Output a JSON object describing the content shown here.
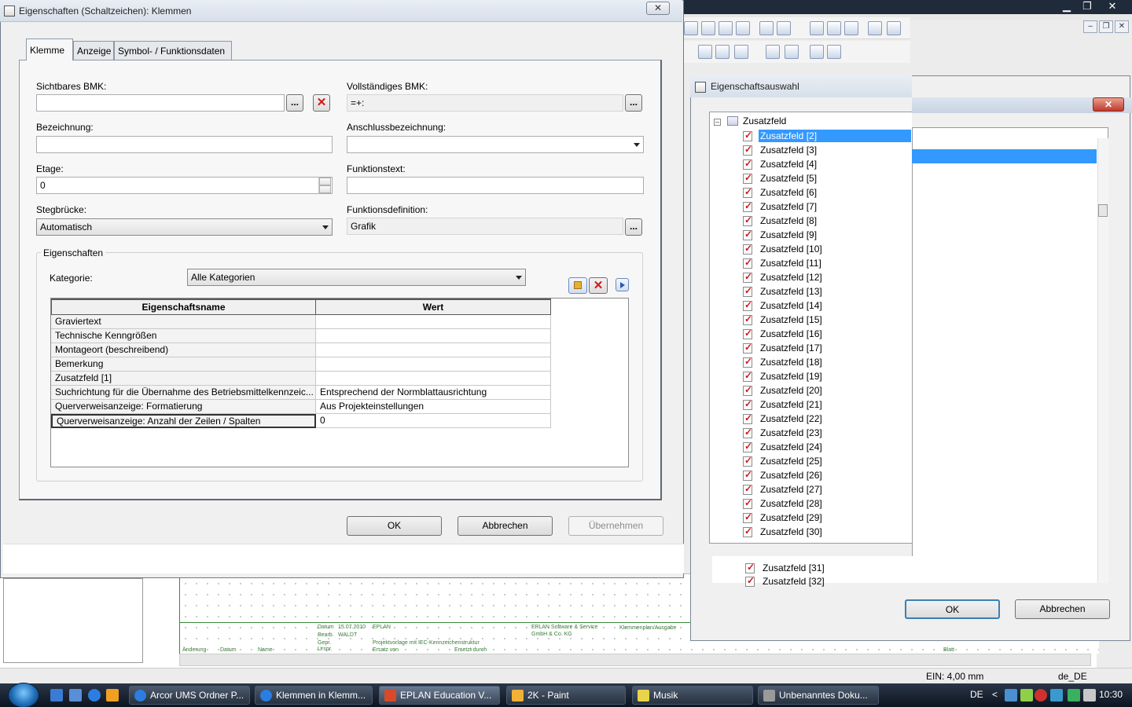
{
  "main_dialog": {
    "title": "Eigenschaften (Schaltzeichen): Klemmen",
    "close_glyph": "✕",
    "tabs": [
      "Klemme",
      "Anzeige",
      "Symbol- / Funktionsdaten"
    ],
    "fields": {
      "sichtbares_bmk": {
        "label": "Sichtbares BMK:",
        "value": ""
      },
      "vollstaendiges_bmk": {
        "label": "Vollständiges BMK:",
        "value": "=+:"
      },
      "bezeichnung": {
        "label": "Bezeichnung:",
        "value": ""
      },
      "anschlussbezeichnung": {
        "label": "Anschlussbezeichnung:",
        "value": ""
      },
      "etage": {
        "label": "Etage:",
        "value": "0"
      },
      "funktionstext": {
        "label": "Funktionstext:",
        "value": ""
      },
      "stegbruecke": {
        "label": "Stegbrücke:",
        "value": "Automatisch"
      },
      "funktionsdefinition": {
        "label": "Funktionsdefinition:",
        "value": "Grafik"
      }
    },
    "dots_label": "...",
    "delete_glyph": "✕",
    "properties_group": {
      "title": "Eigenschaften",
      "category_label": "Kategorie:",
      "category_value": "Alle Kategorien",
      "columns": [
        "Eigenschaftsname",
        "Wert"
      ],
      "rows": [
        {
          "name": "Graviertext",
          "value": ""
        },
        {
          "name": "Technische Kenngrößen",
          "value": ""
        },
        {
          "name": "Montageort (beschreibend)",
          "value": ""
        },
        {
          "name": "Bemerkung",
          "value": ""
        },
        {
          "name": "Zusatzfeld [1]",
          "value": ""
        },
        {
          "name": "Suchrichtung für die Übernahme des Betriebsmittelkennzeic...",
          "value": "Entsprechend der Normblattausrichtung"
        },
        {
          "name": "Querverweisanzeige: Formatierung",
          "value": "Aus Projekteinstellungen"
        },
        {
          "name": "Querverweisanzeige: Anzahl der Zeilen / Spalten",
          "value": "0"
        }
      ],
      "selected_row": 7
    },
    "buttons": {
      "ok": "OK",
      "cancel": "Abbrechen",
      "apply": "Übernehmen"
    }
  },
  "selection_dialog": {
    "title": "Eigenschaftsauswahl",
    "close_glyph": "✕",
    "root": "Zusatzfeld",
    "items": [
      "Zusatzfeld [2]",
      "Zusatzfeld [3]",
      "Zusatzfeld [4]",
      "Zusatzfeld [5]",
      "Zusatzfeld [6]",
      "Zusatzfeld [7]",
      "Zusatzfeld [8]",
      "Zusatzfeld [9]",
      "Zusatzfeld [10]",
      "Zusatzfeld [11]",
      "Zusatzfeld [12]",
      "Zusatzfeld [13]",
      "Zusatzfeld [14]",
      "Zusatzfeld [15]",
      "Zusatzfeld [16]",
      "Zusatzfeld [17]",
      "Zusatzfeld [18]",
      "Zusatzfeld [19]",
      "Zusatzfeld [20]",
      "Zusatzfeld [21]",
      "Zusatzfeld [22]",
      "Zusatzfeld [23]",
      "Zusatzfeld [24]",
      "Zusatzfeld [25]",
      "Zusatzfeld [26]",
      "Zusatzfeld [27]",
      "Zusatzfeld [28]",
      "Zusatzfeld [29]",
      "Zusatzfeld [30]"
    ],
    "tail_items": [
      "Zusatzfeld [31]",
      "Zusatzfeld [32]"
    ],
    "selected_item": 0,
    "buttons": {
      "ok": "OK",
      "cancel": "Abbrechen"
    }
  },
  "background_app": {
    "window_buttons": [
      "▁",
      "❐",
      "✕"
    ],
    "mdi_buttons": [
      "–",
      "❐",
      "✕"
    ],
    "status_ein": "EIN: 4,00 mm",
    "status_locale": "de_DE",
    "titleblock_cells": [
      "Datum",
      "15.07.2010",
      "Bearb.",
      "WALDT",
      "Gepr.",
      "Urspr.",
      "EPLAN",
      "Projektvorlage mit IEC-Kennzeichenstruktur",
      "Ersatz von",
      "Ersetzt durch",
      "EPLAN Software & Service",
      "GmbH & Co. KG",
      "Klemmenplan/Ausgabe",
      "Änderung",
      "Datum",
      "Name",
      "Blatt"
    ]
  },
  "taskbar": {
    "items": [
      {
        "label": "Arcor UMS Ordner P...",
        "icon_color": "#2b7de1"
      },
      {
        "label": "Klemmen in Klemm...",
        "icon_color": "#2b7de1"
      },
      {
        "label": "EPLAN Education V...",
        "icon_color": "#d94a2a"
      },
      {
        "label": "2K - Paint",
        "icon_color": "#f2b134"
      },
      {
        "label": "Musik",
        "icon_color": "#e8d44a"
      },
      {
        "label": "Unbenanntes Doku...",
        "icon_color": "#9a9a9a"
      }
    ],
    "active_index": 2,
    "language": "DE",
    "tray_arrow": "<",
    "clock": "10:30"
  }
}
